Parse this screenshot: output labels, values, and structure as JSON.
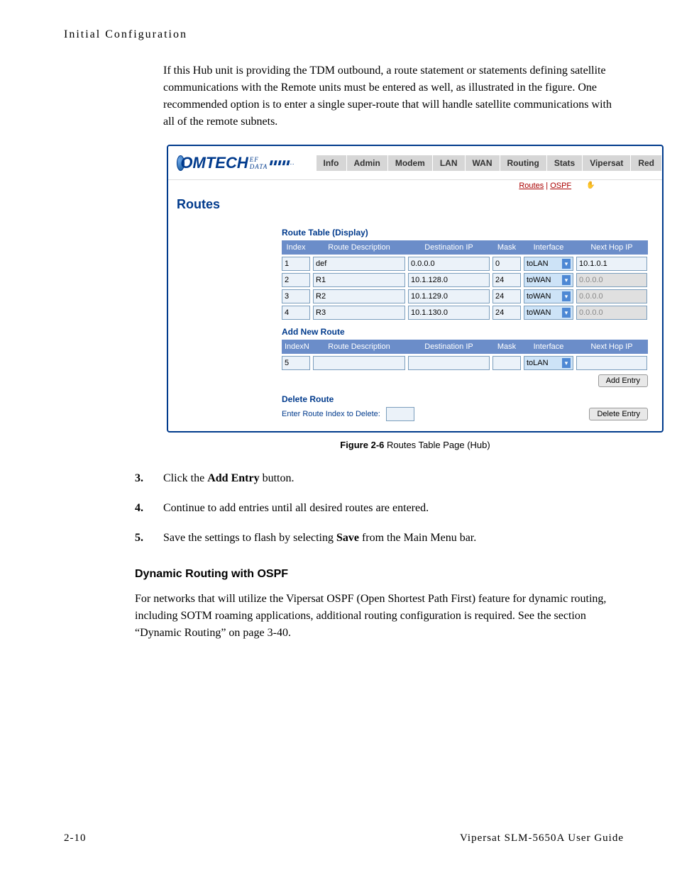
{
  "header": "Initial Configuration",
  "p1": "If this Hub unit is providing the TDM outbound, a route statement or statements defining satellite communications with the Remote units must be entered as well, as illustrated in the figure. One recommended option is to enter a single super-route that will handle satellite communications with all of the remote subnets.",
  "panel": {
    "brand_main": "OMTECH",
    "brand_sub": "EF DATA",
    "nav": [
      "Info",
      "Admin",
      "Modem",
      "LAN",
      "WAN",
      "Routing",
      "Stats",
      "Vipersat",
      "Red"
    ],
    "subnav_routes": "Routes",
    "subnav_sep": " | ",
    "subnav_ospf": "OSPF",
    "title": "Routes",
    "table": {
      "title": "Route Table (Display)",
      "headers": {
        "idx": "Index",
        "desc": "Route Description",
        "dest": "Destination IP",
        "mask": "Mask",
        "ifc": "Interface",
        "nh": "Next Hop IP"
      },
      "rows": [
        {
          "idx": "1",
          "desc": "def",
          "dest": "0.0.0.0",
          "mask": "0",
          "ifc": "toLAN",
          "nh": "10.1.0.1",
          "nh_readonly": false
        },
        {
          "idx": "2",
          "desc": "R1",
          "dest": "10.1.128.0",
          "mask": "24",
          "ifc": "toWAN",
          "nh": "0.0.0.0",
          "nh_readonly": true
        },
        {
          "idx": "3",
          "desc": "R2",
          "dest": "10.1.129.0",
          "mask": "24",
          "ifc": "toWAN",
          "nh": "0.0.0.0",
          "nh_readonly": true
        },
        {
          "idx": "4",
          "desc": "R3",
          "dest": "10.1.130.0",
          "mask": "24",
          "ifc": "toWAN",
          "nh": "0.0.0.0",
          "nh_readonly": true
        }
      ]
    },
    "addnew": {
      "title": "Add New Route",
      "headers": {
        "idx": "IndexN",
        "desc": "Route Description",
        "dest": "Destination IP",
        "mask": "Mask",
        "ifc": "Interface",
        "nh": "Next Hop IP"
      },
      "row": {
        "idx": "5",
        "desc": "",
        "dest": "",
        "mask": "",
        "ifc": "toLAN",
        "nh": ""
      },
      "entry_btn": "Add Entry"
    },
    "del": {
      "title": "Delete Route",
      "label": "Enter Route Index to Delete:",
      "btn": "Delete Entry"
    }
  },
  "fig_caption_b": "Figure 2-6",
  "fig_caption_t": "   Routes Table Page (Hub)",
  "steps": [
    {
      "n": "3.",
      "t_pre": "Click the ",
      "t_b": "Add Entry",
      "t_post": " button."
    },
    {
      "n": "4.",
      "t_pre": "Continue to add entries until all desired routes are entered.",
      "t_b": "",
      "t_post": ""
    },
    {
      "n": "5.",
      "t_pre": "Save the settings to flash by selecting ",
      "t_b": "Save",
      "t_post": " from the Main Menu bar."
    }
  ],
  "subhead": "Dynamic Routing with OSPF",
  "p2": "For networks that will utilize the Vipersat OSPF (Open Shortest Path First) feature for dynamic routing, including SOTM roaming applications, additional routing configuration is required. See the section “Dynamic Routing” on page 3-40.",
  "footer_left": "2-10",
  "footer_right": "Vipersat SLM-5650A User Guide"
}
